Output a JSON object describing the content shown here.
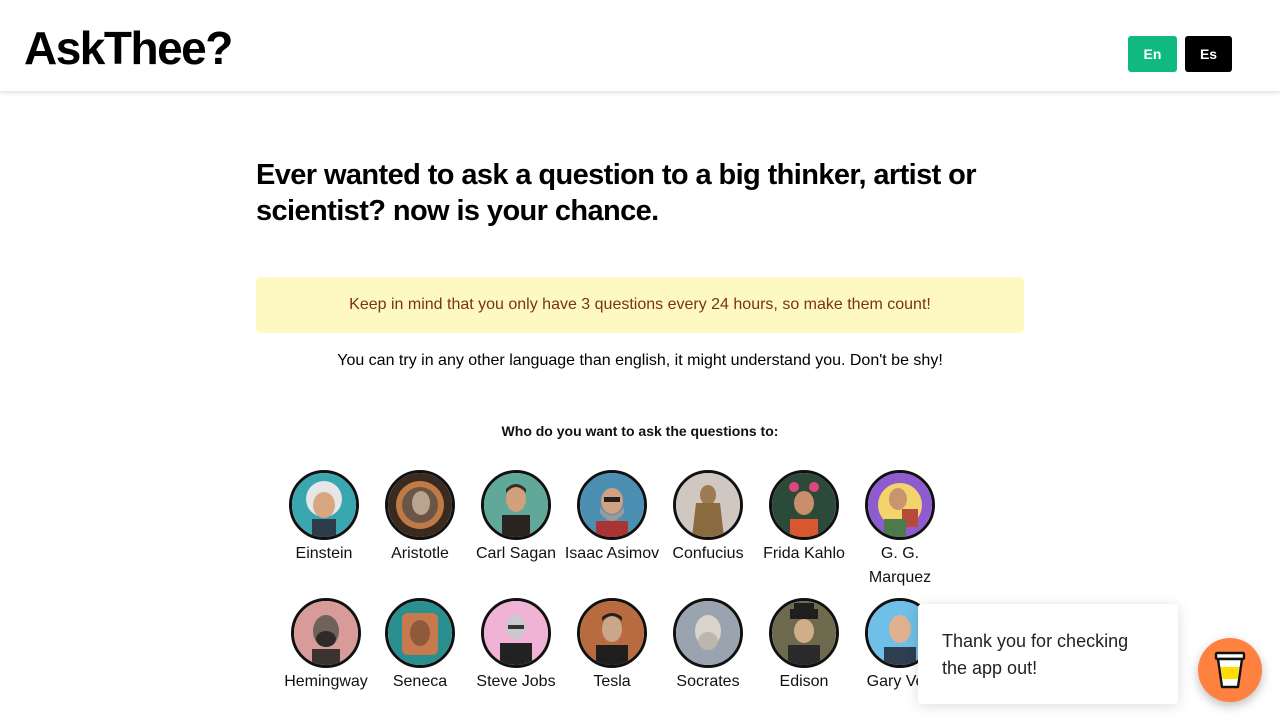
{
  "header": {
    "logo": "AskThee?",
    "languages": [
      {
        "label": "En",
        "color": "#10b981"
      },
      {
        "label": "Es",
        "color": "#000000"
      }
    ]
  },
  "main": {
    "headline": "Ever wanted to ask a question to a big thinker, artist or scientist? now is your chance.",
    "notice": "Keep in mind that you only have 3 questions every 24 hours, so make them count!",
    "tip": "You can try in any other language than english, it might understand you. Don't be shy!",
    "prompt": "Who do you want to ask the questions to:"
  },
  "people": [
    {
      "name": "Einstein"
    },
    {
      "name": "Aristotle"
    },
    {
      "name": "Carl Sagan"
    },
    {
      "name": "Isaac Asimov"
    },
    {
      "name": "Confucius"
    },
    {
      "name": "Frida Kahlo"
    },
    {
      "name": "G. G. Marquez"
    },
    {
      "name": "Hemingway"
    },
    {
      "name": "Seneca"
    },
    {
      "name": "Steve Jobs"
    },
    {
      "name": "Tesla"
    },
    {
      "name": "Socrates"
    },
    {
      "name": "Edison"
    },
    {
      "name": "Gary Vee"
    }
  ],
  "popup": {
    "message": "Thank you for checking the app out!"
  },
  "support_button": {
    "icon": "coffee-cup-icon",
    "color": "#ff813f"
  }
}
